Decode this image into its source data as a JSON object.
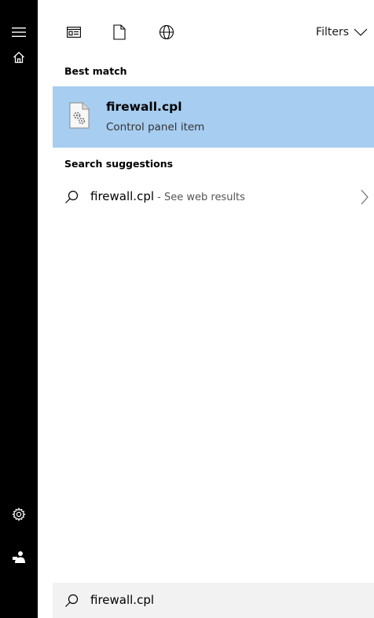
{
  "sidebar": {
    "items": [
      {
        "icon": "hamburger-menu-icon"
      },
      {
        "icon": "home-icon"
      },
      {
        "icon": "settings-gear-icon"
      },
      {
        "icon": "feedback-user-icon"
      }
    ],
    "color": "#000000"
  },
  "filterbar": {
    "icons": [
      "apps-icon",
      "document-icon",
      "web-globe-icon"
    ],
    "filters_label": "Filters"
  },
  "best_match": {
    "header": "Best match",
    "title": "firewall.cpl",
    "subtitle": "Control panel item",
    "highlight_color": "#a7cdf0"
  },
  "suggestions": {
    "header": "Search suggestions",
    "items": [
      {
        "query": "firewall.cpl",
        "separator": " - ",
        "hint": "See web results"
      }
    ]
  },
  "search": {
    "value": "firewall.cpl",
    "box_color": "#f2f2f2"
  }
}
